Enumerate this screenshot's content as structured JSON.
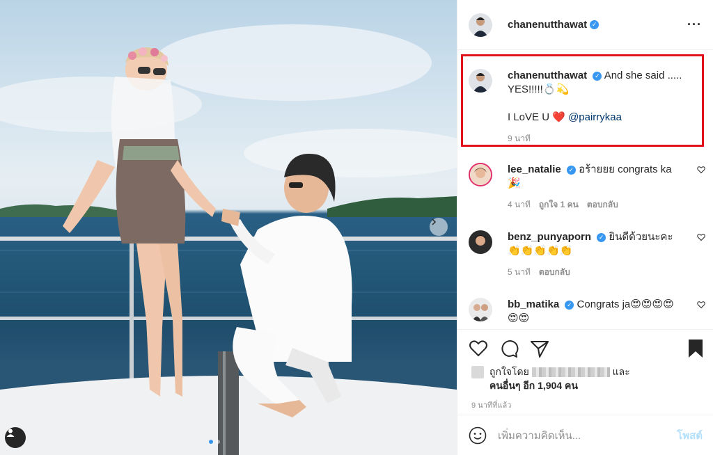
{
  "post": {
    "username": "chanenutthawat",
    "more_icon": "more-horizontal-icon"
  },
  "caption": {
    "username": "chanenutthawat",
    "line1": "And she said .....",
    "line2": "YES!!!!!💍💫",
    "line3_text": "I LoVE U",
    "heart": "❤️",
    "mention": "@pairrykaa",
    "time": "9 นาที"
  },
  "comments": [
    {
      "username": "lee_natalie",
      "text": "อร้ายยย congrats ka",
      "text2": "🎉",
      "time": "4 นาที",
      "likes": "ถูกใจ 1 คน",
      "reply": "ตอบกลับ"
    },
    {
      "username": "benz_punyaporn",
      "text": "ยินดีด้วยนะคะ",
      "text2": "👏👏👏👏👏",
      "time": "5 นาที",
      "likes": "",
      "reply": "ตอบกลับ"
    },
    {
      "username": "bb_matika",
      "text": "Congrats ja😍😍😍😍",
      "text2": "😍😍",
      "time": "",
      "likes": "",
      "reply": ""
    }
  ],
  "likes": {
    "prefix": "ถูกใจโดย",
    "suffix": "และ",
    "line2": "คนอื่นๆ อีก 1,904 คน"
  },
  "timestamp": "9 นาทีที่แล้ว",
  "add_comment": {
    "placeholder": "เพิ่มความคิดเห็น...",
    "post_label": "โพสต์"
  },
  "colors": {
    "highlight_box": "#e0131b",
    "verified": "#3897f0",
    "mention": "#00376b"
  }
}
